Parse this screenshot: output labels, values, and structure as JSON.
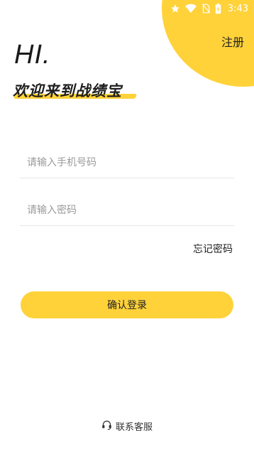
{
  "status_bar": {
    "time": "3:43",
    "icons": [
      "star-icon",
      "wifi-icon",
      "no-sim-icon",
      "battery-charging-icon"
    ]
  },
  "header": {
    "register_label": "注册",
    "greeting": "HI.",
    "welcome_text": "欢迎来到战绩宝"
  },
  "form": {
    "phone_placeholder": "请输入手机号码",
    "password_placeholder": "请输入密码",
    "forgot_label": "忘记密码",
    "login_label": "确认登录"
  },
  "footer": {
    "contact_label": "联系客服",
    "contact_icon": "headset-icon"
  },
  "colors": {
    "accent": "#FFD23A",
    "text": "#222222",
    "placeholder": "#9a9a9a",
    "divider": "#e6e6e6"
  }
}
